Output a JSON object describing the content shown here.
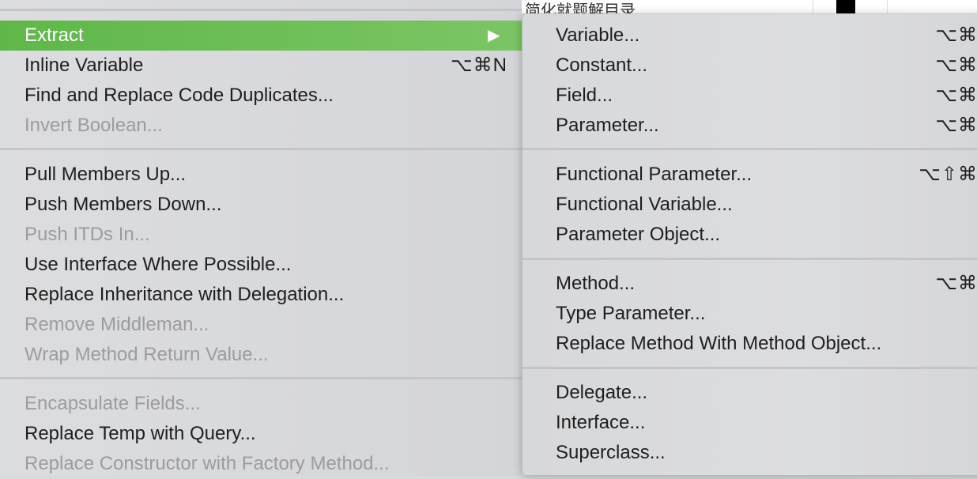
{
  "background": {
    "partial_text": "简化就题解目录"
  },
  "menu": {
    "items": [
      {
        "label": "Extract",
        "shortcut": "",
        "submenu_arrow": "▶",
        "state": "highlighted"
      },
      {
        "label": "Inline Variable",
        "shortcut": "⌥⌘N",
        "state": "enabled"
      },
      {
        "label": "Find and Replace Code Duplicates...",
        "shortcut": "",
        "state": "enabled"
      },
      {
        "label": "Invert Boolean...",
        "shortcut": "",
        "state": "disabled"
      },
      {
        "label": "Pull Members Up...",
        "shortcut": "",
        "state": "enabled"
      },
      {
        "label": "Push Members Down...",
        "shortcut": "",
        "state": "enabled"
      },
      {
        "label": "Push ITDs In...",
        "shortcut": "",
        "state": "disabled"
      },
      {
        "label": "Use Interface Where Possible...",
        "shortcut": "",
        "state": "enabled"
      },
      {
        "label": "Replace Inheritance with Delegation...",
        "shortcut": "",
        "state": "enabled"
      },
      {
        "label": "Remove Middleman...",
        "shortcut": "",
        "state": "disabled"
      },
      {
        "label": "Wrap Method Return Value...",
        "shortcut": "",
        "state": "disabled"
      },
      {
        "label": "Encapsulate Fields...",
        "shortcut": "",
        "state": "disabled"
      },
      {
        "label": "Replace Temp with Query...",
        "shortcut": "",
        "state": "enabled"
      },
      {
        "label": "Replace Constructor with Factory Method...",
        "shortcut": "",
        "state": "disabled"
      }
    ]
  },
  "submenu": {
    "items": [
      {
        "label": "Variable...",
        "shortcut": "⌥⌘"
      },
      {
        "label": "Constant...",
        "shortcut": "⌥⌘"
      },
      {
        "label": "Field...",
        "shortcut": "⌥⌘"
      },
      {
        "label": "Parameter...",
        "shortcut": "⌥⌘"
      },
      {
        "label": "Functional Parameter...",
        "shortcut": "⌥⇧⌘"
      },
      {
        "label": "Functional Variable...",
        "shortcut": ""
      },
      {
        "label": "Parameter Object...",
        "shortcut": ""
      },
      {
        "label": "Method...",
        "shortcut": "⌥⌘"
      },
      {
        "label": "Type Parameter...",
        "shortcut": ""
      },
      {
        "label": "Replace Method With Method Object...",
        "shortcut": ""
      },
      {
        "label": "Delegate...",
        "shortcut": ""
      },
      {
        "label": "Interface...",
        "shortcut": ""
      },
      {
        "label": "Superclass...",
        "shortcut": ""
      }
    ]
  },
  "colors": {
    "highlight": "#6abd55",
    "disabled_text": "#9c9c9e",
    "text": "#1e1e1e"
  }
}
